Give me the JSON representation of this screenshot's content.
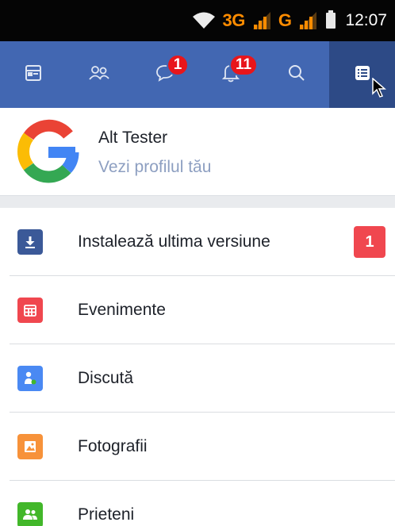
{
  "status_bar": {
    "wifi_icon": "wifi-icon",
    "network_3g": "3G",
    "network_g": "G",
    "time": "12:07"
  },
  "nav": {
    "items": [
      {
        "name": "news-feed",
        "icon": "news-feed-icon"
      },
      {
        "name": "friend-requests",
        "icon": "friends-icon"
      },
      {
        "name": "messages",
        "icon": "chat-icon",
        "badge": "1"
      },
      {
        "name": "notifications",
        "icon": "bell-icon",
        "badge": "11"
      },
      {
        "name": "search",
        "icon": "search-icon"
      },
      {
        "name": "menu",
        "icon": "menu-list-icon",
        "active": true
      }
    ],
    "bar_color": "#4267b2",
    "active_color": "#2d4a86",
    "badge_color": "#e8161b"
  },
  "profile": {
    "name": "Alt Tester",
    "link": "Vezi profilul tău"
  },
  "menu": {
    "items": [
      {
        "label": "Instalează ultima versiune",
        "icon": "download-icon",
        "color": "#3b5998",
        "badge": "1"
      },
      {
        "label": "Evenimente",
        "icon": "calendar-icon",
        "color": "#f0474f"
      },
      {
        "label": "Discută",
        "icon": "contact-icon",
        "color": "#4a89f3"
      },
      {
        "label": "Fotografii",
        "icon": "photo-icon",
        "color": "#f7923a"
      },
      {
        "label": "Prieteni",
        "icon": "friends-icon",
        "color": "#42b72a"
      }
    ]
  }
}
